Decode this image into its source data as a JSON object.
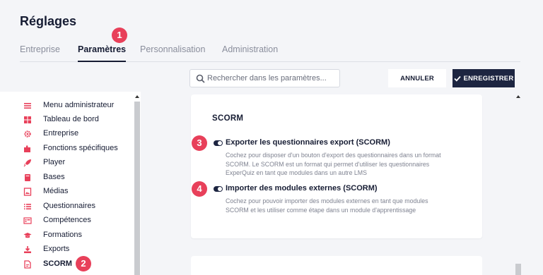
{
  "page_title": "Réglages",
  "tabs": [
    {
      "label": "Entreprise",
      "active": false
    },
    {
      "label": "Paramètres",
      "active": true
    },
    {
      "label": "Personnalisation",
      "active": false
    },
    {
      "label": "Administration",
      "active": false
    }
  ],
  "badges": [
    "1",
    "2",
    "3",
    "4"
  ],
  "search": {
    "placeholder": "Rechercher dans les paramètres..."
  },
  "buttons": {
    "cancel": "ANNULER",
    "save": "ENREGISTRER"
  },
  "sidebar": {
    "items": [
      {
        "label": "Menu administrateur",
        "icon": "menu-icon"
      },
      {
        "label": "Tableau de bord",
        "icon": "dashboard-icon"
      },
      {
        "label": "Entreprise",
        "icon": "gear-icon"
      },
      {
        "label": "Fonctions spécifiques",
        "icon": "puzzle-icon"
      },
      {
        "label": "Player",
        "icon": "rocket-icon"
      },
      {
        "label": "Bases",
        "icon": "books-icon"
      },
      {
        "label": "Médias",
        "icon": "image-icon"
      },
      {
        "label": "Questionnaires",
        "icon": "list-icon"
      },
      {
        "label": "Compétences",
        "icon": "skills-icon"
      },
      {
        "label": "Formations",
        "icon": "graduation-cap-icon"
      },
      {
        "label": "Exports",
        "icon": "download-icon"
      },
      {
        "label": "SCORM",
        "icon": "file-icon",
        "active": true
      }
    ]
  },
  "scorm": {
    "title": "SCORM",
    "options": [
      {
        "label": "Exporter les questionnaires export (SCORM)",
        "enabled": true,
        "desc": [
          "Cochez pour disposer d'un bouton d'export des questionnaires dans un format",
          "SCORM. Le SCORM est un format qui permet d'utiliser les questionnaires",
          "ExperQuiz en tant que modules dans un autre LMS"
        ]
      },
      {
        "label": "Importer des modules externes (SCORM)",
        "enabled": true,
        "desc": [
          "Cochez pour pouvoir importer des modules externes en tant que modules",
          "SCORM et les utiliser comme étape dans un module d'apprentissage"
        ]
      }
    ]
  },
  "colors": {
    "accent": "#1d2541",
    "icon": "#e8405a",
    "badge": "#e8405a",
    "background": "#f4f5f8"
  }
}
